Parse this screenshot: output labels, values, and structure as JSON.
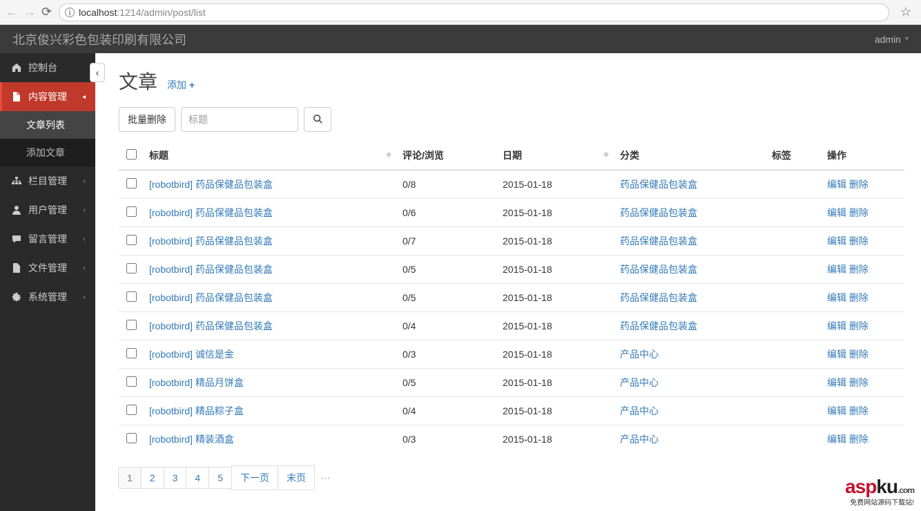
{
  "browser": {
    "host": "localhost",
    "path": ":1214/admin/post/list"
  },
  "brand": "北京俊兴彩色包装印刷有限公司",
  "user": "admin",
  "sidebar": {
    "items": [
      {
        "label": "控制台",
        "icon": "dashboard"
      },
      {
        "label": "内容管理",
        "icon": "file",
        "active": true,
        "children": [
          {
            "label": "文章列表",
            "active": true
          },
          {
            "label": "添加文章"
          }
        ]
      },
      {
        "label": "栏目管理",
        "icon": "sitemap"
      },
      {
        "label": "用户管理",
        "icon": "user"
      },
      {
        "label": "留言管理",
        "icon": "comment"
      },
      {
        "label": "文件管理",
        "icon": "file2"
      },
      {
        "label": "系统管理",
        "icon": "gear"
      }
    ]
  },
  "page": {
    "title": "文章",
    "add_label": "添加"
  },
  "toolbar": {
    "batch_delete": "批量删除",
    "search_placeholder": "标题"
  },
  "table": {
    "headers": {
      "title": "标题",
      "views": "评论/浏览",
      "date": "日期",
      "category": "分类",
      "tag": "标签",
      "ops": "操作"
    },
    "ops": {
      "edit": "编辑",
      "delete": "删除"
    },
    "author": "[robotbird]",
    "rows": [
      {
        "title": "药品保健品包装盒",
        "views": "0/8",
        "date": "2015-01-18",
        "category": "药品保健品包装盒"
      },
      {
        "title": "药品保健品包装盒",
        "views": "0/6",
        "date": "2015-01-18",
        "category": "药品保健品包装盒"
      },
      {
        "title": "药品保健品包装盒",
        "views": "0/7",
        "date": "2015-01-18",
        "category": "药品保健品包装盒"
      },
      {
        "title": "药品保健品包装盒",
        "views": "0/5",
        "date": "2015-01-18",
        "category": "药品保健品包装盒"
      },
      {
        "title": "药品保健品包装盒",
        "views": "0/5",
        "date": "2015-01-18",
        "category": "药品保健品包装盒"
      },
      {
        "title": "药品保健品包装盒",
        "views": "0/4",
        "date": "2015-01-18",
        "category": "药品保健品包装盒"
      },
      {
        "title": "诚信是金",
        "views": "0/3",
        "date": "2015-01-18",
        "category": "产品中心"
      },
      {
        "title": "精品月饼盒",
        "views": "0/5",
        "date": "2015-01-18",
        "category": "产品中心"
      },
      {
        "title": "精品粽子盒",
        "views": "0/4",
        "date": "2015-01-18",
        "category": "产品中心"
      },
      {
        "title": "精装酒盒",
        "views": "0/3",
        "date": "2015-01-18",
        "category": "产品中心"
      }
    ]
  },
  "pagination": {
    "pages": [
      "1",
      "2",
      "3",
      "4",
      "5"
    ],
    "next": "下一页",
    "last": "末页"
  },
  "watermark": {
    "logo1": "asp",
    "logo2": "ku",
    "dotcom": ".com",
    "tagline": "免费网站源码下载站!"
  },
  "icons": {
    "dashboard": "⌂",
    "file": "▤",
    "sitemap": "⚏",
    "user": "👤",
    "comment": "💬",
    "file2": "▤",
    "gear": "⚙"
  }
}
